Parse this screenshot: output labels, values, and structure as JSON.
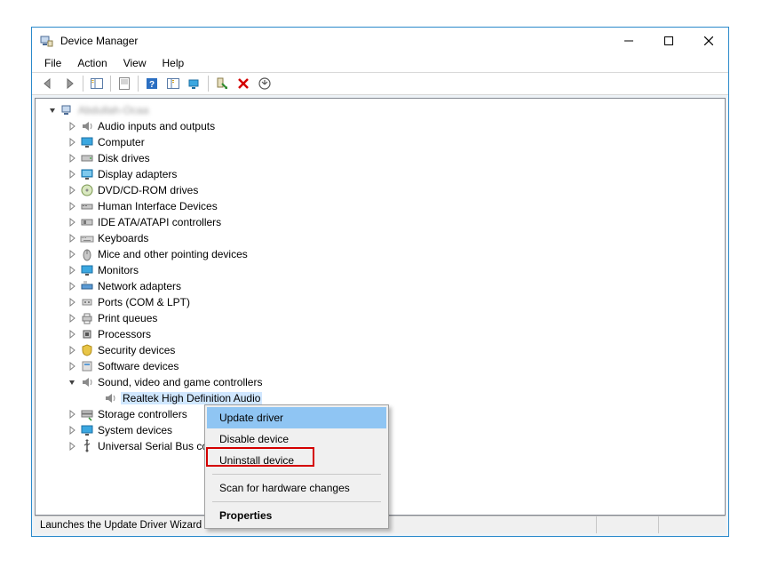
{
  "window": {
    "title": "Device Manager"
  },
  "menubar": {
    "file": "File",
    "action": "Action",
    "view": "View",
    "help": "Help"
  },
  "tree": {
    "root_label": "Abdullah-Ocaa",
    "categories": [
      {
        "name": "audio-inputs-outputs",
        "label": "Audio inputs and outputs",
        "icon": "speaker"
      },
      {
        "name": "computer",
        "label": "Computer",
        "icon": "monitor"
      },
      {
        "name": "disk-drives",
        "label": "Disk drives",
        "icon": "drive"
      },
      {
        "name": "display-adapters",
        "label": "Display adapters",
        "icon": "display"
      },
      {
        "name": "dvd-cdrom",
        "label": "DVD/CD-ROM drives",
        "icon": "disc"
      },
      {
        "name": "hid",
        "label": "Human Interface Devices",
        "icon": "hid"
      },
      {
        "name": "ide",
        "label": "IDE ATA/ATAPI controllers",
        "icon": "ide"
      },
      {
        "name": "keyboards",
        "label": "Keyboards",
        "icon": "keyboard"
      },
      {
        "name": "mice",
        "label": "Mice and other pointing devices",
        "icon": "mouse"
      },
      {
        "name": "monitors",
        "label": "Monitors",
        "icon": "monitor-device"
      },
      {
        "name": "network",
        "label": "Network adapters",
        "icon": "network"
      },
      {
        "name": "ports",
        "label": "Ports (COM & LPT)",
        "icon": "port"
      },
      {
        "name": "print-queues",
        "label": "Print queues",
        "icon": "printer"
      },
      {
        "name": "processors",
        "label": "Processors",
        "icon": "cpu"
      },
      {
        "name": "security",
        "label": "Security devices",
        "icon": "shield"
      },
      {
        "name": "software",
        "label": "Software devices",
        "icon": "software"
      },
      {
        "name": "sound",
        "label": "Sound, video and game controllers",
        "icon": "speaker",
        "expanded": true,
        "children": [
          {
            "name": "realtek-hd-audio",
            "label": "Realtek High Definition Audio",
            "icon": "speaker",
            "selected": true
          }
        ]
      },
      {
        "name": "storage-controllers",
        "label": "Storage controllers",
        "icon": "storage"
      },
      {
        "name": "system-devices",
        "label": "System devices",
        "icon": "system"
      },
      {
        "name": "usb",
        "label": "Universal Serial Bus controllers",
        "icon": "usb"
      }
    ]
  },
  "context_menu": {
    "update_driver": "Update driver",
    "disable_device": "Disable device",
    "uninstall_device": "Uninstall device",
    "scan_hardware": "Scan for hardware changes",
    "properties": "Properties"
  },
  "statusbar": {
    "text": "Launches the Update Driver Wizard for the selected device."
  }
}
